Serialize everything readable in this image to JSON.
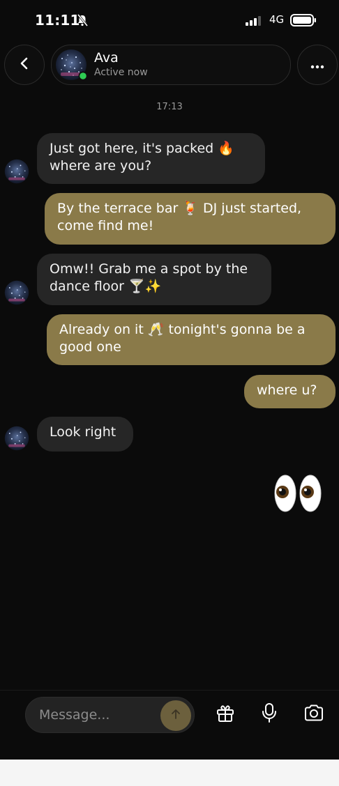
{
  "status_bar": {
    "time": "11:11",
    "network": "4G"
  },
  "header": {
    "name": "Ava",
    "status": "Active now",
    "icons": {
      "back": "chevron-left-icon",
      "more": "more-horizontal-icon"
    }
  },
  "chat": {
    "timestamp": "17:13",
    "messages": [
      {
        "from": "Ava",
        "text": "Just got here, it's packed 🔥\nwhere are you?"
      },
      {
        "from": "me",
        "text": "By the terrace bar 🍹 DJ just started,\ncome find me!"
      },
      {
        "from": "Ava",
        "text": "Omw!! Grab me a spot by the\ndance floor 🍸✨"
      },
      {
        "from": "me",
        "text": "Already on it 🥂 tonight's gonna be a\ngood one"
      },
      {
        "from": "me",
        "text": "where u?"
      },
      {
        "from": "Ava",
        "text": "Look right"
      },
      {
        "from": "me",
        "text": "👀"
      }
    ]
  },
  "composer": {
    "placeholder": "Message...",
    "icons": [
      "send-arrow-icon",
      "gift-icon",
      "microphone-icon",
      "camera-icon"
    ]
  },
  "colors": {
    "background": "#0b0b0b",
    "incoming_bubble": "#262626",
    "outgoing_bubble": "#8a7a49",
    "send_button": "#6c603d",
    "online": "#2ecc53"
  }
}
